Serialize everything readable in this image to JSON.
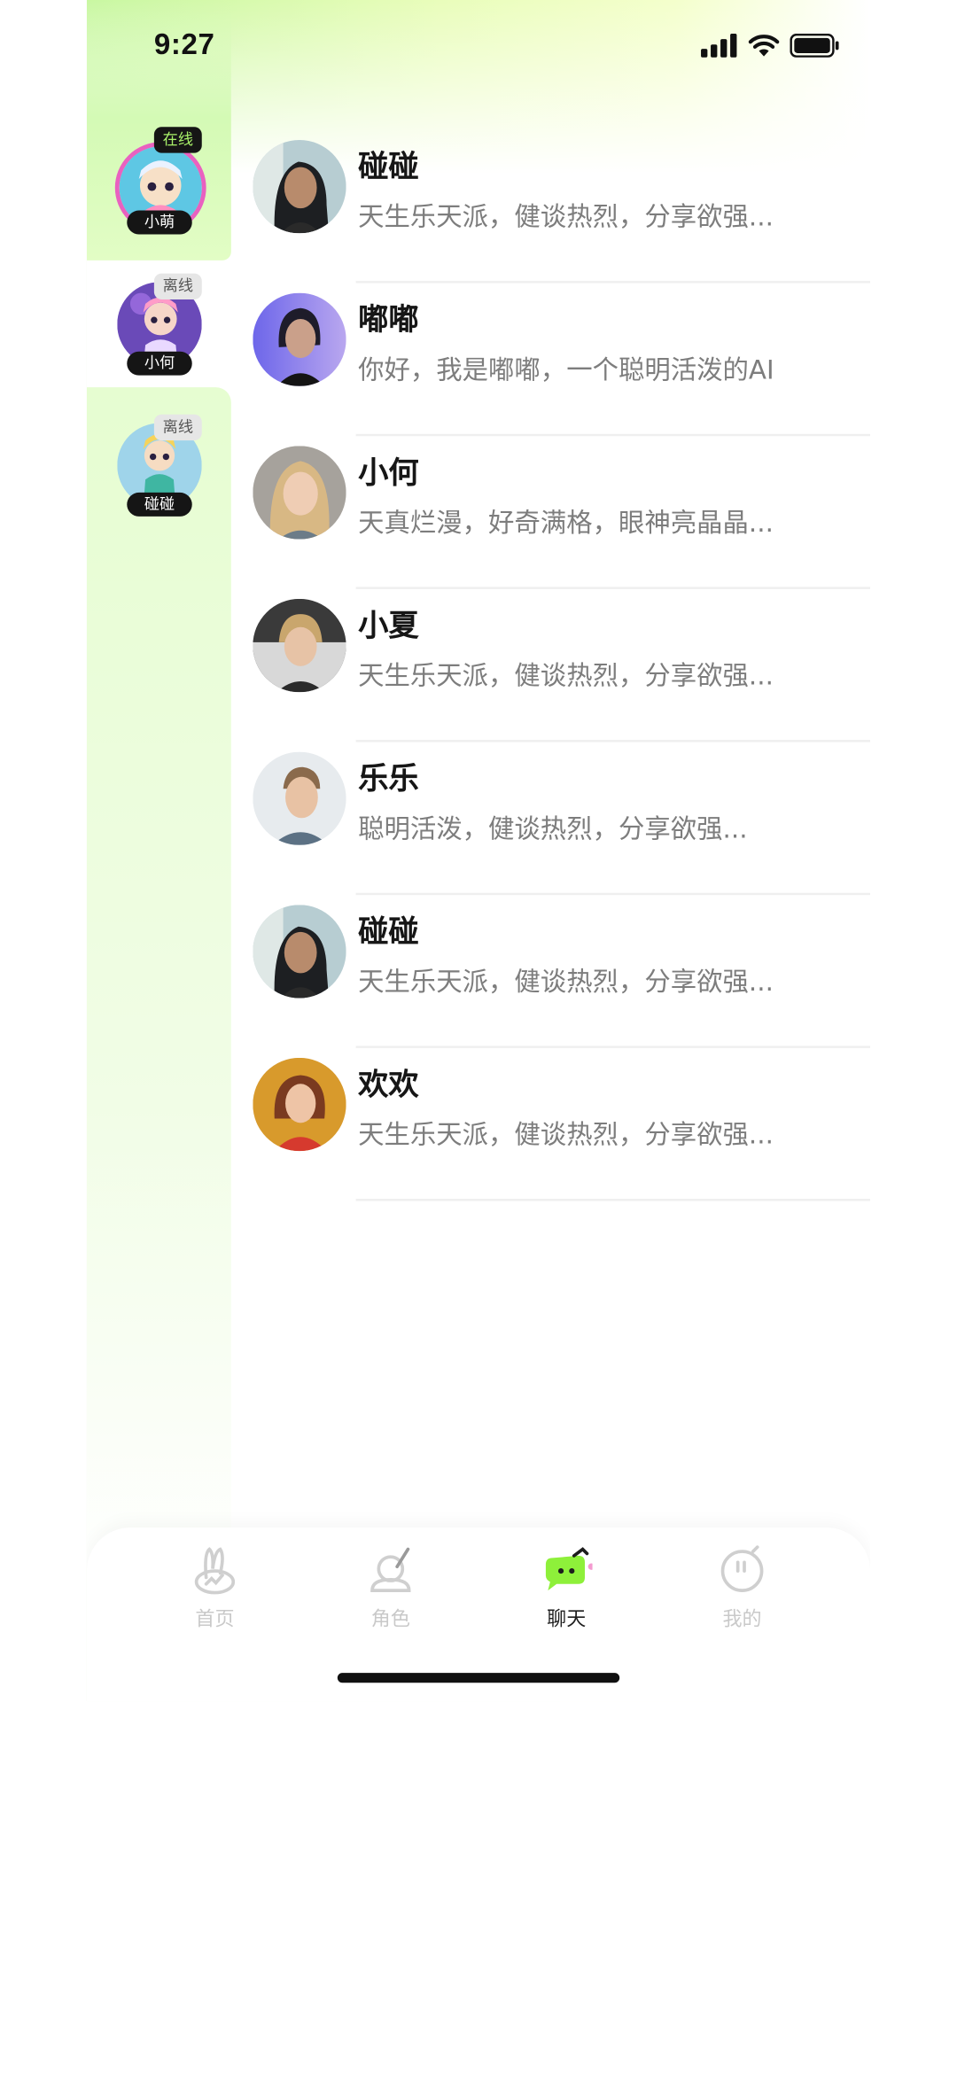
{
  "status_bar": {
    "time": "9:27",
    "icons": [
      "signal-icon",
      "wifi-icon",
      "battery-icon"
    ]
  },
  "sidebar": {
    "items": [
      {
        "name": "小萌",
        "status": "在线",
        "active": true
      },
      {
        "name": "小何",
        "status": "离线",
        "active": false
      },
      {
        "name": "碰碰",
        "status": "离线",
        "active": false
      }
    ]
  },
  "chats": [
    {
      "name": "碰碰",
      "preview": "天生乐天派，健谈热烈，分享欲强..."
    },
    {
      "name": "嘟嘟",
      "preview": "你好，我是嘟嘟，一个聪明活泼的AI"
    },
    {
      "name": "小何",
      "preview": "天真烂漫，好奇满格，眼神亮晶晶..."
    },
    {
      "name": "小夏",
      "preview": "天生乐天派，健谈热烈，分享欲强..."
    },
    {
      "name": "乐乐",
      "preview": "聪明活泼，健谈热烈，分享欲强..."
    },
    {
      "name": "碰碰",
      "preview": "天生乐天派，健谈热烈，分享欲强..."
    },
    {
      "name": "欢欢",
      "preview": "天生乐天派，健谈热烈，分享欲强..."
    }
  ],
  "tab_bar": {
    "tabs": [
      {
        "label": "首页",
        "icon": "rabbit-home-icon",
        "active": false
      },
      {
        "label": "角色",
        "icon": "character-icon",
        "active": false
      },
      {
        "label": "聊天",
        "icon": "chat-icon",
        "active": true
      },
      {
        "label": "我的",
        "icon": "profile-icon",
        "active": false
      }
    ]
  },
  "colors": {
    "accent": "#8ef03a",
    "online_text": "#a8f069",
    "active_ring": "#e961c0"
  }
}
